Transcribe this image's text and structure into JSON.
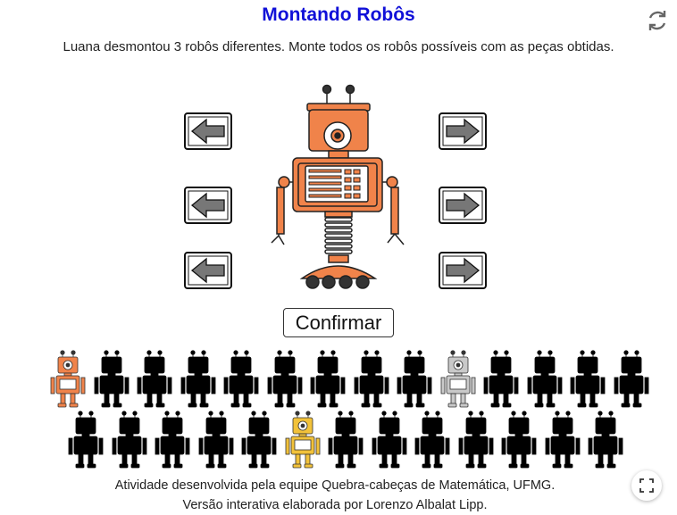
{
  "title": "Montando Robôs",
  "instructions": "Luana desmontou 3 robôs diferentes. Monte todos os robôs possíveis com as peças obtidas.",
  "icons": {
    "reset": "reset-icon",
    "fullscreen": "fullscreen-icon",
    "arrow_left": "arrow-left-icon",
    "arrow_right": "arrow-right-icon"
  },
  "confirm_label": "Confirmar",
  "robot_colors": {
    "orange": "#f0834a",
    "gray": "#c9c9c9",
    "yellow": "#f2c23a",
    "silhouette": "#000000"
  },
  "gallery": {
    "row1": [
      "orange",
      "silhouette",
      "silhouette",
      "silhouette",
      "silhouette",
      "silhouette",
      "silhouette",
      "silhouette",
      "silhouette",
      "gray",
      "silhouette",
      "silhouette",
      "silhouette",
      "silhouette"
    ],
    "row2": [
      "silhouette",
      "silhouette",
      "silhouette",
      "silhouette",
      "silhouette",
      "yellow",
      "silhouette",
      "silhouette",
      "silhouette",
      "silhouette",
      "silhouette",
      "silhouette",
      "silhouette"
    ]
  },
  "credits": {
    "line1": "Atividade desenvolvida pela equipe Quebra-cabeças de Matemática, UFMG.",
    "line2": "Versão interativa elaborada por Lorenzo Albalat Lipp."
  }
}
